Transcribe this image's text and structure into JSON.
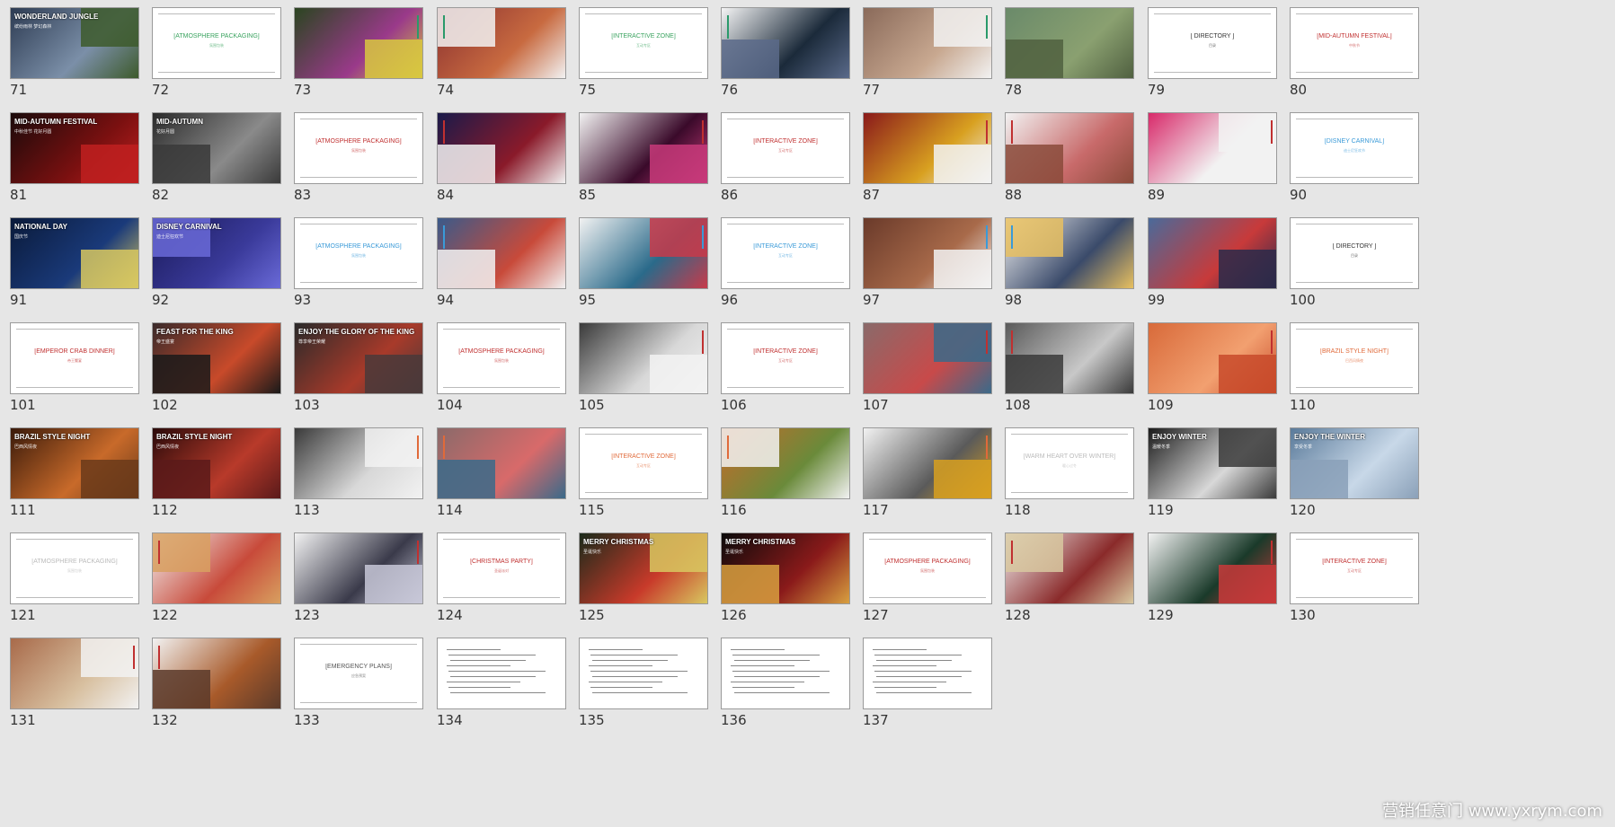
{
  "watermark": "营销任意门 www.yxrym.com",
  "slides": [
    {
      "n": "71",
      "k": "photo",
      "cap": "WONDERLAND JUNGLE",
      "sub": "缤纷雨林 梦幻森林",
      "c": [
        "#2d3b52",
        "#7b8fa8",
        "#3d5a2b"
      ]
    },
    {
      "n": "72",
      "k": "title",
      "cap": "[ATMOSPHERE PACKAGING]",
      "sub": "氛围包装",
      "col": "#3aa35f"
    },
    {
      "n": "73",
      "k": "photo",
      "cap": "",
      "c": [
        "#2a4520",
        "#9a3a8a",
        "#d8c840"
      ],
      "bar": "#2a9a6a"
    },
    {
      "n": "74",
      "k": "photo",
      "cap": "",
      "c": [
        "#8a3030",
        "#c86a40",
        "#f2f2f2"
      ],
      "bar": "#2a9a6a"
    },
    {
      "n": "75",
      "k": "title",
      "cap": "[INTERACTIVE ZONE]",
      "sub": "互动专区",
      "col": "#3aa35f"
    },
    {
      "n": "76",
      "k": "photo",
      "cap": "",
      "c": [
        "#f5f5f5",
        "#1b2a3a",
        "#5a6a8a"
      ],
      "bar": "#2a9a6a"
    },
    {
      "n": "77",
      "k": "photo",
      "cap": "",
      "c": [
        "#8a6a5a",
        "#c8a890",
        "#f2f2f2"
      ],
      "bar": "#2a9a6a"
    },
    {
      "n": "78",
      "k": "photo",
      "cap": "",
      "c": [
        "#6a8a6a",
        "#8aa070",
        "#506040"
      ]
    },
    {
      "n": "79",
      "k": "title",
      "cap": "[ DIRECTORY ]",
      "sub": "目录",
      "col": "#333333"
    },
    {
      "n": "80",
      "k": "title",
      "cap": "[MID-AUTUMN FESTIVAL]",
      "sub": "中秋节",
      "col": "#c03030"
    },
    {
      "n": "81",
      "k": "photo",
      "cap": "MID-AUTUMN FESTIVAL",
      "sub": "中秋佳节 花好月圆",
      "c": [
        "#1a0a0a",
        "#7a1010",
        "#c02020"
      ]
    },
    {
      "n": "82",
      "k": "photo",
      "cap": "MID-AUTUMN",
      "sub": "花好月圆",
      "c": [
        "#2a2a2a",
        "#8a8a8a",
        "#3a3a3a"
      ]
    },
    {
      "n": "83",
      "k": "title",
      "cap": "[ATMOSPHERE PACKAGING]",
      "sub": "氛围包装",
      "col": "#c03030"
    },
    {
      "n": "84",
      "k": "photo",
      "cap": "",
      "c": [
        "#1a1a4a",
        "#8a1a2a",
        "#f2f2f2"
      ],
      "bar": "#c03030"
    },
    {
      "n": "85",
      "k": "photo",
      "cap": "",
      "c": [
        "#f2f2f2",
        "#3a0a2a",
        "#c83a7a"
      ],
      "bar": "#c03030"
    },
    {
      "n": "86",
      "k": "title",
      "cap": "[INTERACTIVE ZONE]",
      "sub": "互动专区",
      "col": "#c03030"
    },
    {
      "n": "87",
      "k": "photo",
      "cap": "",
      "c": [
        "#8a1a1a",
        "#d8a020",
        "#f2f2f2"
      ],
      "bar": "#c03030"
    },
    {
      "n": "88",
      "k": "photo",
      "cap": "",
      "c": [
        "#f2f2f2",
        "#c86a6a",
        "#8a4a3a"
      ],
      "bar": "#c03030"
    },
    {
      "n": "89",
      "k": "photo",
      "cap": "",
      "c": [
        "#d82a6a",
        "#f2f2f2",
        "#f2f2f2"
      ],
      "bar": "#c03030"
    },
    {
      "n": "90",
      "k": "title",
      "cap": "[DISNEY CARNIVAL]",
      "sub": "迪士尼狂欢节",
      "col": "#3a9ad8"
    },
    {
      "n": "91",
      "k": "photo",
      "cap": "NATIONAL DAY",
      "sub": "国庆节",
      "c": [
        "#0a1a3a",
        "#1a3a7a",
        "#d8c860"
      ]
    },
    {
      "n": "92",
      "k": "photo",
      "cap": "DISNEY CARNIVAL",
      "sub": "迪士尼狂欢节",
      "c": [
        "#1a1a5a",
        "#3a3a9a",
        "#6a6ad8"
      ]
    },
    {
      "n": "93",
      "k": "title",
      "cap": "[ATMOSPHERE PACKAGING]",
      "sub": "氛围包装",
      "col": "#3a9ad8"
    },
    {
      "n": "94",
      "k": "photo",
      "cap": "",
      "c": [
        "#3a5a8a",
        "#c84a3a",
        "#f2f2f2"
      ],
      "bar": "#3a9ad8"
    },
    {
      "n": "95",
      "k": "photo",
      "cap": "",
      "c": [
        "#f2f2f2",
        "#2a6a8a",
        "#c83a4a"
      ],
      "bar": "#3a9ad8"
    },
    {
      "n": "96",
      "k": "title",
      "cap": "[INTERACTIVE ZONE]",
      "sub": "互动专区",
      "col": "#3a9ad8"
    },
    {
      "n": "97",
      "k": "photo",
      "cap": "",
      "c": [
        "#6a3a2a",
        "#a86a4a",
        "#f2f2f2"
      ],
      "bar": "#3a9ad8"
    },
    {
      "n": "98",
      "k": "photo",
      "cap": "",
      "c": [
        "#f2f2f2",
        "#3a4a6a",
        "#e8c060"
      ],
      "bar": "#3a9ad8"
    },
    {
      "n": "99",
      "k": "photo",
      "cap": "",
      "c": [
        "#4a6a9a",
        "#c83a3a",
        "#2a2a4a"
      ]
    },
    {
      "n": "100",
      "k": "title",
      "cap": "[ DIRECTORY ]",
      "sub": "目录",
      "col": "#333333"
    },
    {
      "n": "101",
      "k": "title",
      "cap": "[EMPEROR CRAB DINNER]",
      "sub": "帝王蟹宴",
      "col": "#c03030"
    },
    {
      "n": "102",
      "k": "photo",
      "cap": "FEAST FOR THE KING",
      "sub": "帝王盛宴",
      "c": [
        "#3a2a2a",
        "#c84a2a",
        "#1a1a1a"
      ]
    },
    {
      "n": "103",
      "k": "photo",
      "cap": "ENJOY THE GLORY OF THE KING",
      "sub": "尊享帝王荣耀",
      "c": [
        "#2a2a2a",
        "#a83a2a",
        "#4a3a3a"
      ]
    },
    {
      "n": "104",
      "k": "title",
      "cap": "[ATMOSPHERE PACKAGING]",
      "sub": "氛围包装",
      "col": "#c03030"
    },
    {
      "n": "105",
      "k": "photo",
      "cap": "",
      "c": [
        "#3a3a3a",
        "#d8d8d8",
        "#f2f2f2"
      ],
      "bar": "#c03030"
    },
    {
      "n": "106",
      "k": "title",
      "cap": "[INTERACTIVE ZONE]",
      "sub": "互动专区",
      "col": "#c03030"
    },
    {
      "n": "107",
      "k": "photo",
      "cap": "",
      "c": [
        "#8a6a6a",
        "#c84a4a",
        "#3a6a8a"
      ],
      "bar": "#c03030"
    },
    {
      "n": "108",
      "k": "photo",
      "cap": "",
      "c": [
        "#5a5a5a",
        "#c8c8c8",
        "#3a3a3a"
      ],
      "bar": "#c03030"
    },
    {
      "n": "109",
      "k": "photo",
      "cap": "",
      "c": [
        "#d86a3a",
        "#f2a070",
        "#c84a2a"
      ],
      "bar": "#c03030"
    },
    {
      "n": "110",
      "k": "title",
      "cap": "[BRAZIL STYLE NIGHT]",
      "sub": "巴西风情夜",
      "col": "#e06a3a"
    },
    {
      "n": "111",
      "k": "photo",
      "cap": "BRAZIL STYLE NIGHT",
      "sub": "巴西风情夜",
      "c": [
        "#3a1a0a",
        "#c86a2a",
        "#6a3a1a"
      ]
    },
    {
      "n": "112",
      "k": "photo",
      "cap": "BRAZIL STYLE NIGHT",
      "sub": "巴西风情夜",
      "c": [
        "#2a0a0a",
        "#b83a2a",
        "#5a1a1a"
      ]
    },
    {
      "n": "113",
      "k": "photo",
      "cap": "",
      "c": [
        "#3a3a3a",
        "#d8d8d8",
        "#f2f2f2"
      ],
      "bar": "#e06a3a"
    },
    {
      "n": "114",
      "k": "photo",
      "cap": "",
      "c": [
        "#8a6a6a",
        "#d86a6a",
        "#3a6a8a"
      ],
      "bar": "#e06a3a"
    },
    {
      "n": "115",
      "k": "title",
      "cap": "[INTERACTIVE ZONE]",
      "sub": "互动专区",
      "col": "#e06a3a"
    },
    {
      "n": "116",
      "k": "photo",
      "cap": "",
      "c": [
        "#c86a2a",
        "#6a8a3a",
        "#f2f2f2"
      ],
      "bar": "#e06a3a"
    },
    {
      "n": "117",
      "k": "photo",
      "cap": "",
      "c": [
        "#f2f2f2",
        "#5a5a5a",
        "#d8a020"
      ],
      "bar": "#e06a3a"
    },
    {
      "n": "118",
      "k": "title",
      "cap": "[WARM HEART OVER WINTER]",
      "sub": "暖心过冬",
      "col": "#bbbbbb"
    },
    {
      "n": "119",
      "k": "photo",
      "cap": "ENJOY WINTER",
      "sub": "温暖冬季",
      "c": [
        "#1a1a1a",
        "#d8d8d8",
        "#3a3a3a"
      ]
    },
    {
      "n": "120",
      "k": "photo",
      "cap": "ENJOY THE WINTER",
      "sub": "享受冬季",
      "c": [
        "#5a7a9a",
        "#c8d8e8",
        "#8aa0b8"
      ]
    },
    {
      "n": "121",
      "k": "title",
      "cap": "[ATMOSPHERE PACKAGING]",
      "sub": "氛围包装",
      "col": "#bbbbbb"
    },
    {
      "n": "122",
      "k": "photo",
      "cap": "",
      "c": [
        "#f2f2f2",
        "#c84a3a",
        "#d8a060"
      ],
      "bar": "#c03030"
    },
    {
      "n": "123",
      "k": "photo",
      "cap": "",
      "c": [
        "#f2f2f2",
        "#3a3a4a",
        "#c8c8d8"
      ],
      "bar": "#c03030"
    },
    {
      "n": "124",
      "k": "title",
      "cap": "[CHRISTMAS PARTY]",
      "sub": "圣诞派对",
      "col": "#c03030"
    },
    {
      "n": "125",
      "k": "photo",
      "cap": "MERRY CHRISTMAS",
      "sub": "圣诞快乐",
      "c": [
        "#1a2a1a",
        "#c83a2a",
        "#d8c860"
      ]
    },
    {
      "n": "126",
      "k": "photo",
      "cap": "MERRY CHRISTMAS",
      "sub": "圣诞快乐",
      "c": [
        "#0a0a0a",
        "#8a1a1a",
        "#d8a040"
      ]
    },
    {
      "n": "127",
      "k": "title",
      "cap": "[ATMOSPHERE PACKAGING]",
      "sub": "氛围包装",
      "col": "#c03030"
    },
    {
      "n": "128",
      "k": "photo",
      "cap": "",
      "c": [
        "#f2f2f2",
        "#8a2a2a",
        "#d8c8a0"
      ],
      "bar": "#c03030"
    },
    {
      "n": "129",
      "k": "photo",
      "cap": "",
      "c": [
        "#f2f2f2",
        "#1a3a2a",
        "#c83a3a"
      ],
      "bar": "#c03030"
    },
    {
      "n": "130",
      "k": "title",
      "cap": "[INTERACTIVE ZONE]",
      "sub": "互动专区",
      "col": "#c03030"
    },
    {
      "n": "131",
      "k": "photo",
      "cap": "",
      "c": [
        "#a86a4a",
        "#d8c0a0",
        "#f2f2f2"
      ],
      "bar": "#c03030"
    },
    {
      "n": "132",
      "k": "photo",
      "cap": "",
      "c": [
        "#f2f2f2",
        "#a85a2a",
        "#5a3a2a"
      ],
      "bar": "#c03030"
    },
    {
      "n": "133",
      "k": "title",
      "cap": "[EMERGENCY PLANS]",
      "sub": "应急预案",
      "col": "#555555"
    },
    {
      "n": "134",
      "k": "doc",
      "cap": "",
      "c": [
        "#ffffff",
        "#3a3a3a",
        "#888888"
      ]
    },
    {
      "n": "135",
      "k": "doc",
      "cap": "",
      "c": [
        "#ffffff",
        "#888888",
        "#888888"
      ]
    },
    {
      "n": "136",
      "k": "doc",
      "cap": "",
      "c": [
        "#ffffff",
        "#888888",
        "#888888"
      ]
    },
    {
      "n": "137",
      "k": "doc",
      "cap": "",
      "c": [
        "#ffffff",
        "#888888",
        "#888888"
      ]
    }
  ]
}
